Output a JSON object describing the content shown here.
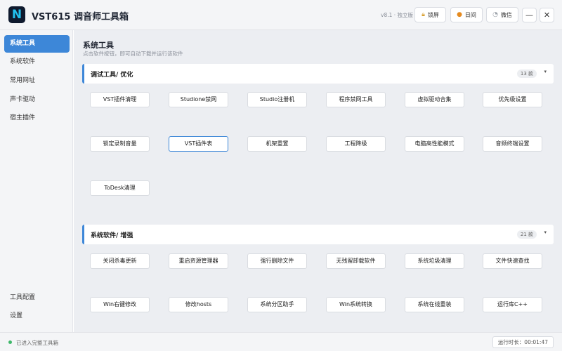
{
  "app": {
    "logo_letter": "N",
    "title": "VST615 调音师工具箱",
    "version": "v8.1 · 独立版"
  },
  "header_buttons": {
    "lock": {
      "icon": "lock-icon",
      "label": "锁屏"
    },
    "calendar": {
      "icon": "calendar-icon",
      "label": "日间"
    },
    "wechat": {
      "icon": "wechat-icon",
      "label": "微信"
    },
    "minimize": "—",
    "close": "✕"
  },
  "sidebar": {
    "items": [
      {
        "label": "系统工具",
        "active": true
      },
      {
        "label": "系统软件",
        "active": false
      },
      {
        "label": "常用网址",
        "active": false
      },
      {
        "label": "声卡驱动",
        "active": false
      },
      {
        "label": "宿主插件",
        "active": false
      }
    ],
    "bottom_items": [
      {
        "label": "工具配置"
      },
      {
        "label": "设置"
      }
    ]
  },
  "main": {
    "title": "系统工具",
    "subtitle": "点击软件按钮，即可自动下载并运行该软件",
    "sections": [
      {
        "title": "调试工具/ 优化",
        "count": "13 款",
        "tools": [
          "VST插件清理",
          "Studione禁网",
          "Studio注册机",
          "程序禁网工具",
          "虚拟驱动合集",
          "优先级设置",
          "锁定录制音量",
          "VST插件表",
          "机架重置",
          "工程降级",
          "电脑高性能模式",
          "音频终端设置",
          "ToDesk清理"
        ]
      },
      {
        "title": "系统软件/ 增强",
        "count": "21 款",
        "tools": [
          "关闭杀毒更新",
          "重启资源管理器",
          "强行删除文件",
          "无残留卸载软件",
          "系统垃圾清理",
          "文件快速查找",
          "Win右键修改",
          "修改hosts",
          "系统分区助手",
          "Win系统转换",
          "系统在线重装",
          "运行库C++"
        ]
      }
    ]
  },
  "status": {
    "text": "已进入完整工具箱",
    "runtime": "运行时长：00:01:47"
  },
  "colors": {
    "accent": "#3d87d8",
    "status_ok": "#3fb86a"
  }
}
